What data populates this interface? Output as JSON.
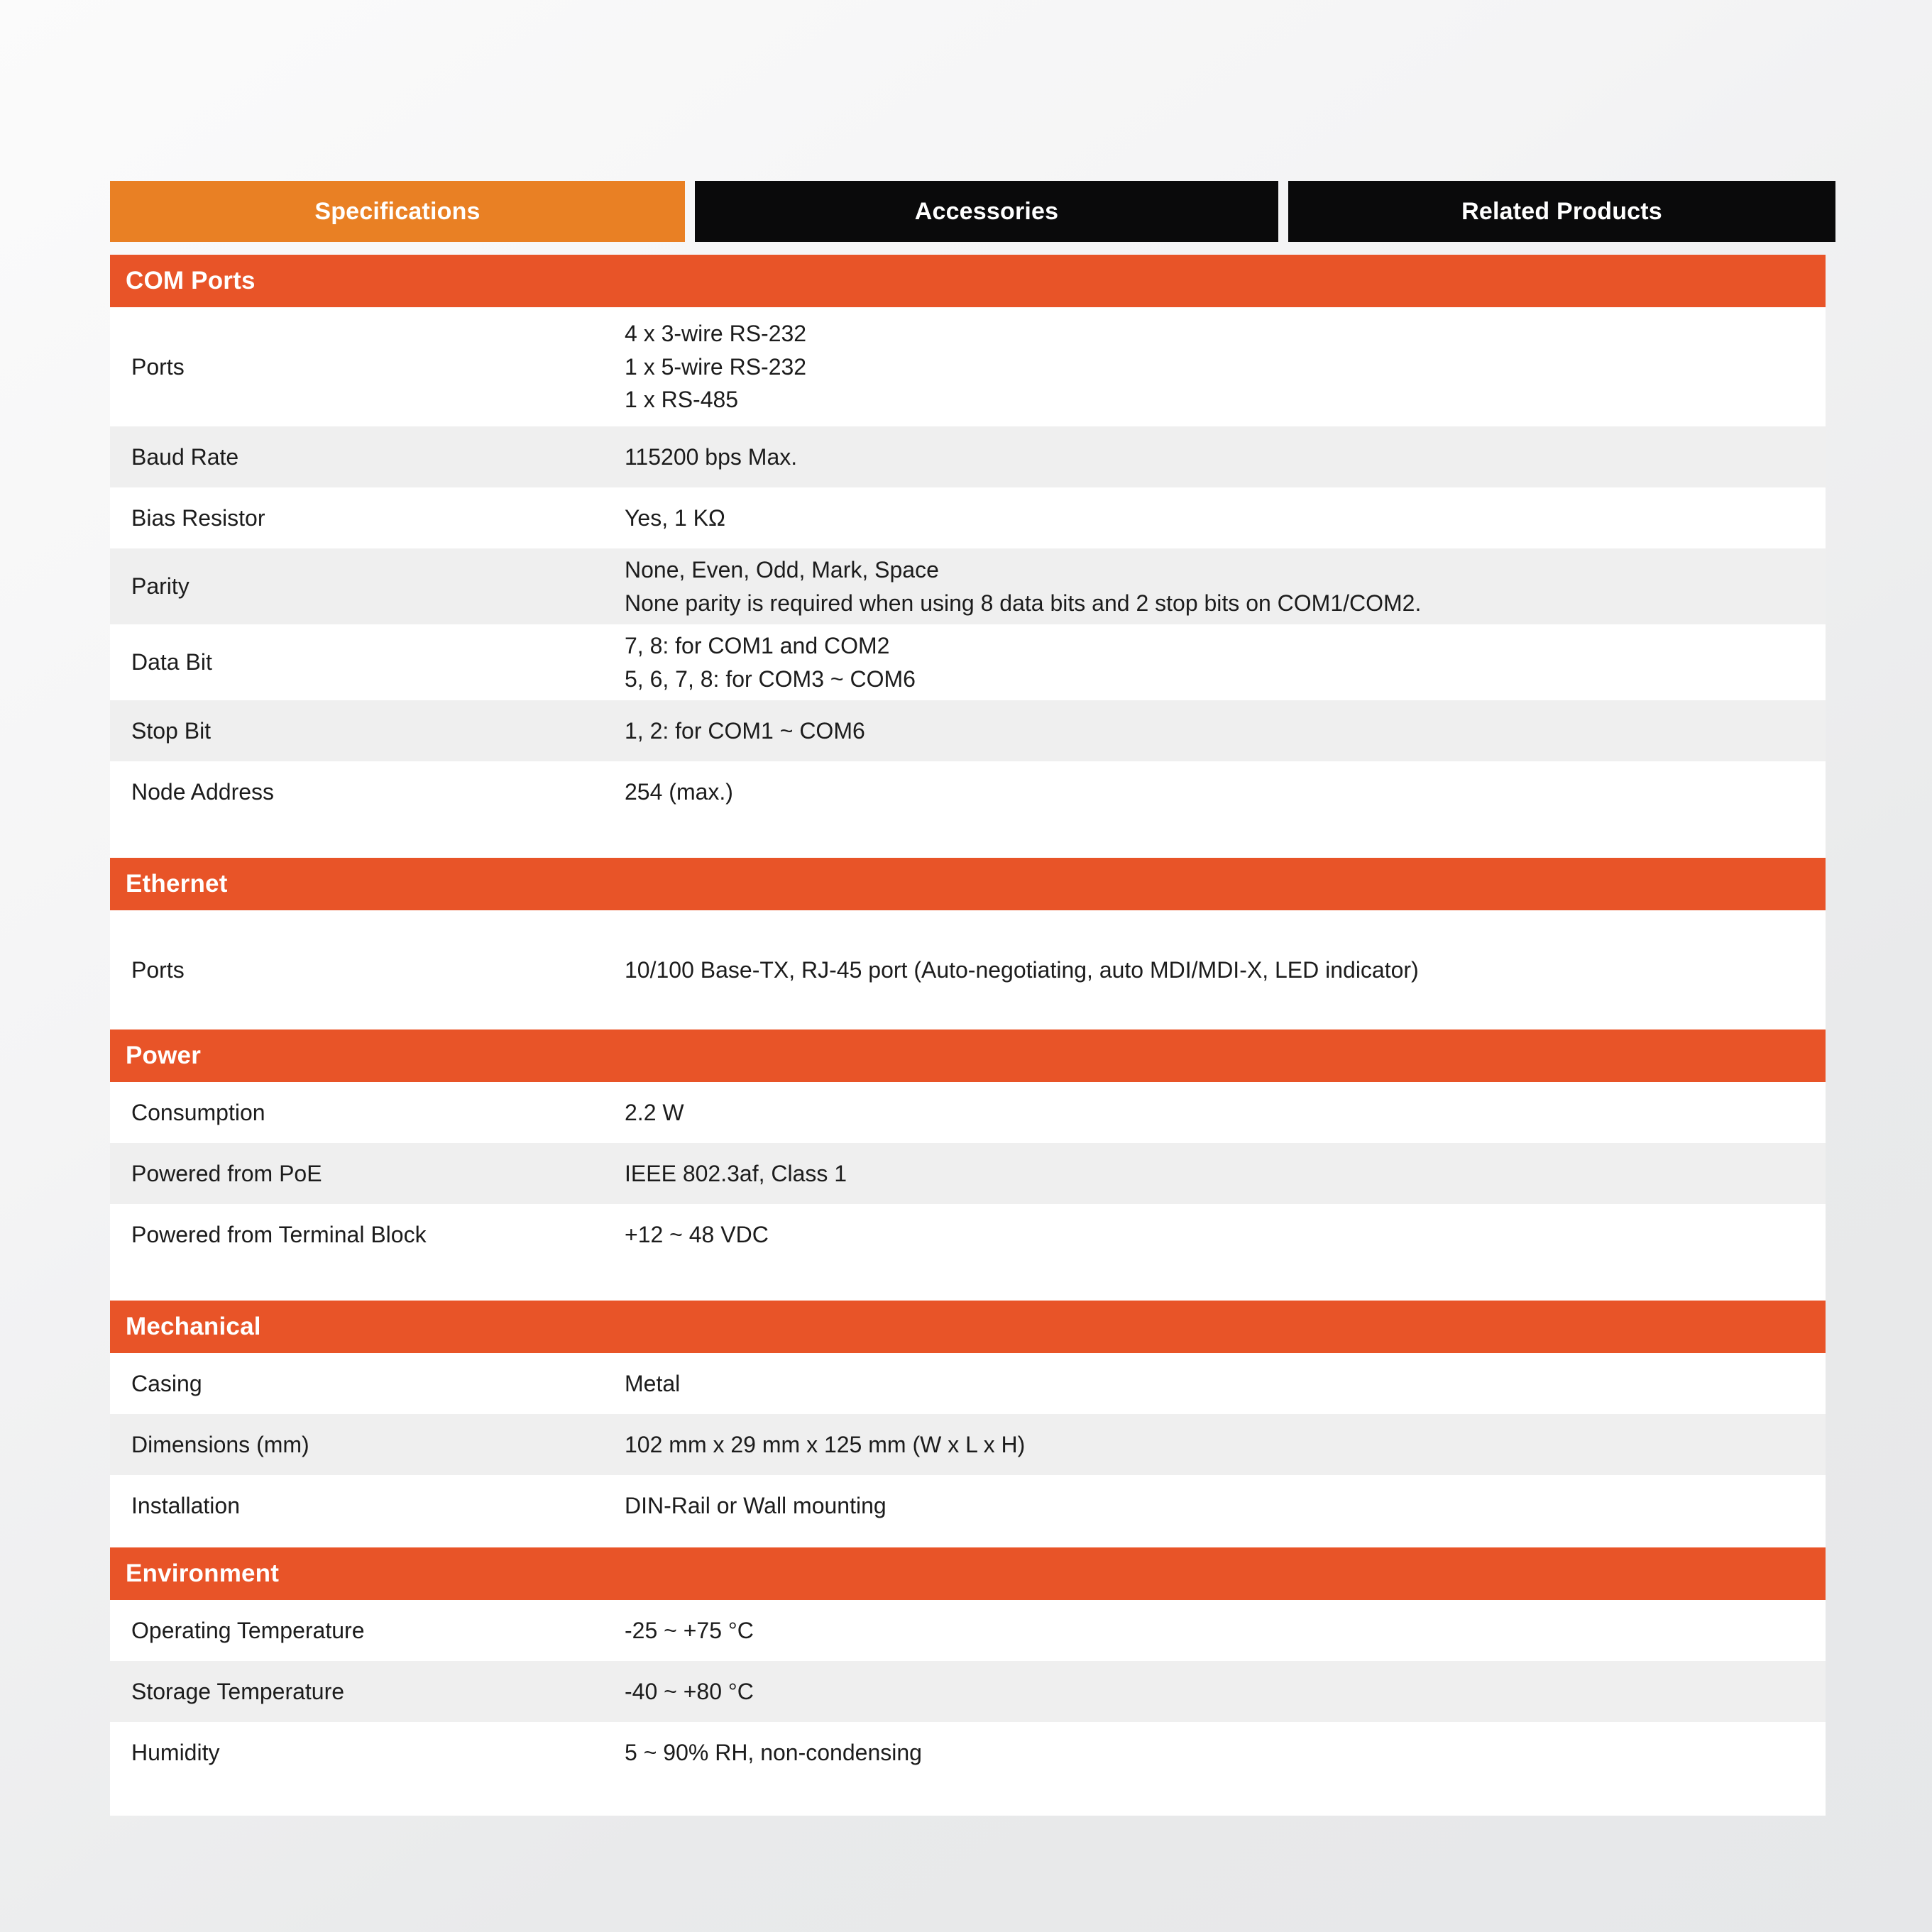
{
  "tabs": [
    {
      "label": "Specifications",
      "active": true
    },
    {
      "label": "Accessories",
      "active": false
    },
    {
      "label": "Related Products",
      "active": false
    }
  ],
  "colors": {
    "tab_active": "#E98024",
    "tab_inactive": "#0A0A0B",
    "section_header": "#E85428",
    "row_alt": "#EFEFEF",
    "row_base": "#FFFFFF",
    "text": "#1C1C1C",
    "page_background": "#F2F3F4"
  },
  "sections": [
    {
      "title": "COM Ports",
      "rows": [
        {
          "label": "Ports",
          "values": [
            "4 x 3-wire RS-232",
            "1 x 5-wire RS-232",
            "1 x RS-485"
          ]
        },
        {
          "label": "Baud Rate",
          "values": [
            "115200 bps Max."
          ]
        },
        {
          "label": "Bias Resistor",
          "values": [
            "Yes, 1 KΩ"
          ]
        },
        {
          "label": "Parity",
          "values": [
            "None, Even, Odd, Mark, Space",
            "None parity is required when using 8 data bits and 2 stop bits on COM1/COM2."
          ]
        },
        {
          "label": "Data Bit",
          "values": [
            "7, 8: for COM1 and COM2",
            "5, 6, 7, 8: for COM3 ~ COM6"
          ]
        },
        {
          "label": "Stop Bit",
          "values": [
            "1, 2: for COM1 ~ COM6"
          ]
        },
        {
          "label": "Node Address",
          "values": [
            "254 (max.)"
          ]
        }
      ]
    },
    {
      "title": "Ethernet",
      "rows": [
        {
          "label": "Ports",
          "values": [
            "10/100 Base-TX, RJ-45 port (Auto-negotiating, auto MDI/MDI-X, LED indicator)"
          ]
        }
      ]
    },
    {
      "title": "Power",
      "rows": [
        {
          "label": "Consumption",
          "values": [
            "2.2 W"
          ]
        },
        {
          "label": "Powered from PoE",
          "values": [
            "IEEE 802.3af, Class 1"
          ]
        },
        {
          "label": "Powered from Terminal Block",
          "values": [
            "+12 ~ 48 VDC"
          ]
        }
      ]
    },
    {
      "title": "Mechanical",
      "rows": [
        {
          "label": "Casing",
          "values": [
            "Metal"
          ]
        },
        {
          "label": "Dimensions (mm)",
          "values": [
            "102 mm x 29 mm x 125 mm (W x L x H)"
          ]
        },
        {
          "label": "Installation",
          "values": [
            "DIN-Rail or Wall mounting"
          ]
        }
      ]
    },
    {
      "title": "Environment",
      "rows": [
        {
          "label": "Operating Temperature",
          "values": [
            "-25 ~ +75 °C"
          ]
        },
        {
          "label": "Storage Temperature",
          "values": [
            "-40 ~ +80 °C"
          ]
        },
        {
          "label": "Humidity",
          "values": [
            "5 ~ 90% RH, non-condensing"
          ]
        }
      ]
    }
  ]
}
